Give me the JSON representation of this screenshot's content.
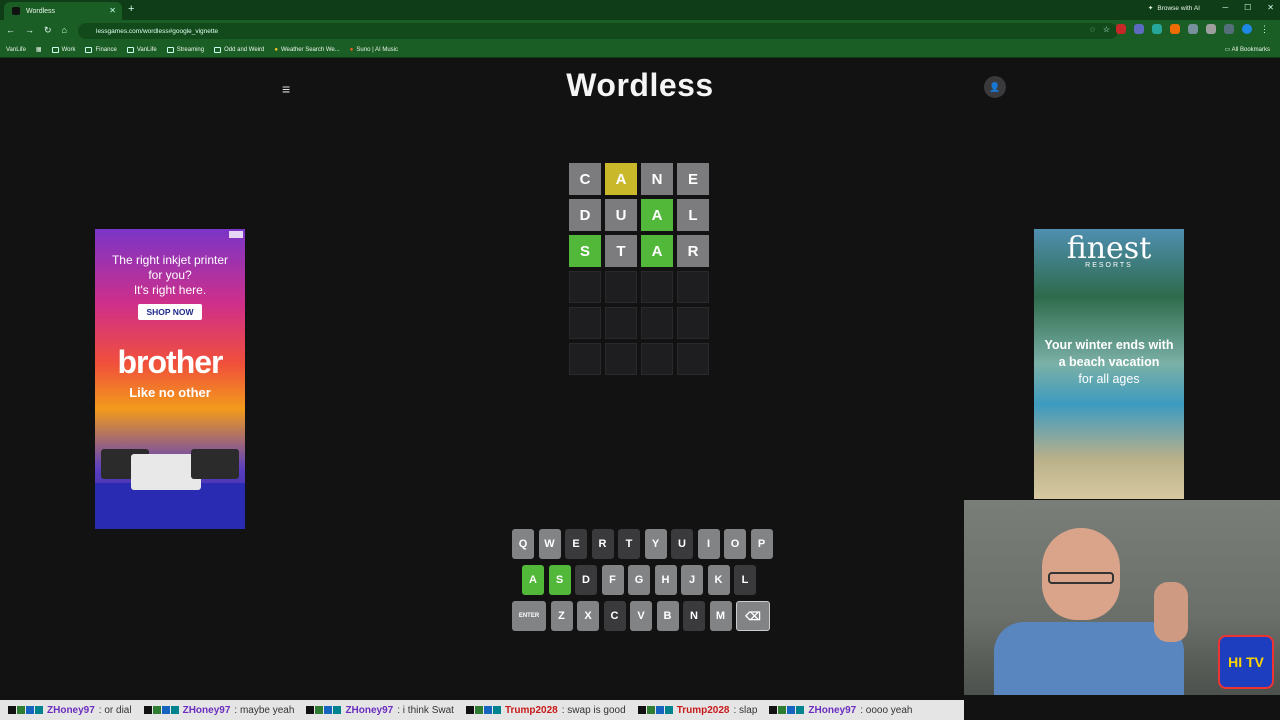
{
  "browser": {
    "tab_title": "Wordless",
    "browse_ai": "Browse with AI",
    "url": "lessgames.com/wordless#google_vignette",
    "bookmarks": [
      "VanLife",
      "Work",
      "Finance",
      "VanLife",
      "Streaming",
      "Odd and Weird",
      "Weather Search We...",
      "Suno | AI Music"
    ],
    "all_bookmarks": "All Bookmarks"
  },
  "game": {
    "title": "Wordless",
    "grid": [
      [
        {
          "l": "C",
          "s": "gray"
        },
        {
          "l": "A",
          "s": "yellow"
        },
        {
          "l": "N",
          "s": "gray"
        },
        {
          "l": "E",
          "s": "gray"
        }
      ],
      [
        {
          "l": "D",
          "s": "gray"
        },
        {
          "l": "U",
          "s": "gray"
        },
        {
          "l": "A",
          "s": "green"
        },
        {
          "l": "L",
          "s": "gray"
        }
      ],
      [
        {
          "l": "S",
          "s": "green"
        },
        {
          "l": "T",
          "s": "gray"
        },
        {
          "l": "A",
          "s": "green"
        },
        {
          "l": "R",
          "s": "gray"
        }
      ],
      [
        {
          "l": "",
          "s": "empty"
        },
        {
          "l": "",
          "s": "empty"
        },
        {
          "l": "",
          "s": "empty"
        },
        {
          "l": "",
          "s": "empty"
        }
      ],
      [
        {
          "l": "",
          "s": "empty"
        },
        {
          "l": "",
          "s": "empty"
        },
        {
          "l": "",
          "s": "empty"
        },
        {
          "l": "",
          "s": "empty"
        }
      ],
      [
        {
          "l": "",
          "s": "empty"
        },
        {
          "l": "",
          "s": "empty"
        },
        {
          "l": "",
          "s": "empty"
        },
        {
          "l": "",
          "s": "empty"
        }
      ]
    ],
    "keyboard": {
      "row1": [
        {
          "k": "Q",
          "s": "gray"
        },
        {
          "k": "W",
          "s": "gray"
        },
        {
          "k": "E",
          "s": "dark"
        },
        {
          "k": "R",
          "s": "dark"
        },
        {
          "k": "T",
          "s": "dark"
        },
        {
          "k": "Y",
          "s": "gray"
        },
        {
          "k": "U",
          "s": "dark"
        },
        {
          "k": "I",
          "s": "gray"
        },
        {
          "k": "O",
          "s": "gray"
        },
        {
          "k": "P",
          "s": "gray"
        }
      ],
      "row2": [
        {
          "k": "A",
          "s": "green"
        },
        {
          "k": "S",
          "s": "green"
        },
        {
          "k": "D",
          "s": "dark"
        },
        {
          "k": "F",
          "s": "gray"
        },
        {
          "k": "G",
          "s": "gray"
        },
        {
          "k": "H",
          "s": "gray"
        },
        {
          "k": "J",
          "s": "gray"
        },
        {
          "k": "K",
          "s": "gray"
        },
        {
          "k": "L",
          "s": "dark"
        }
      ],
      "row3": [
        {
          "k": "ENTER",
          "s": "gray"
        },
        {
          "k": "Z",
          "s": "gray"
        },
        {
          "k": "X",
          "s": "gray"
        },
        {
          "k": "C",
          "s": "dark"
        },
        {
          "k": "V",
          "s": "gray"
        },
        {
          "k": "B",
          "s": "gray"
        },
        {
          "k": "N",
          "s": "dark"
        },
        {
          "k": "M",
          "s": "gray"
        },
        {
          "k": "⌫",
          "s": "back"
        }
      ]
    }
  },
  "ads": {
    "left": {
      "line1": "The right inkjet printer",
      "line2": "for you?",
      "line3": "It's right here.",
      "button": "SHOP NOW",
      "brand": "brother",
      "tagline": "Like no other"
    },
    "right": {
      "brand": "finest",
      "sub": "RESORTS",
      "msg1": "Your winter ends with",
      "msg1b": "a beach vacation",
      "msg2": "for all ages"
    }
  },
  "webcam": {
    "logo": "HI TV"
  },
  "ticker": [
    {
      "user": "ZHoney97",
      "msg": ": or dial",
      "red": false
    },
    {
      "user": "ZHoney97",
      "msg": ": maybe yeah",
      "red": false
    },
    {
      "user": "ZHoney97",
      "msg": ": i think Swat",
      "red": false
    },
    {
      "user": "Trump2028",
      "msg": ": swap is good",
      "red": true
    },
    {
      "user": "Trump2028",
      "msg": ": slap",
      "red": true
    },
    {
      "user": "ZHoney97",
      "msg": ": oooo yeah",
      "red": false
    }
  ],
  "colors": {
    "tile_green": "#52b83a",
    "tile_yellow": "#c9b92a",
    "tile_gray": "#7c7c7e",
    "browser_green": "#1b5e25"
  }
}
